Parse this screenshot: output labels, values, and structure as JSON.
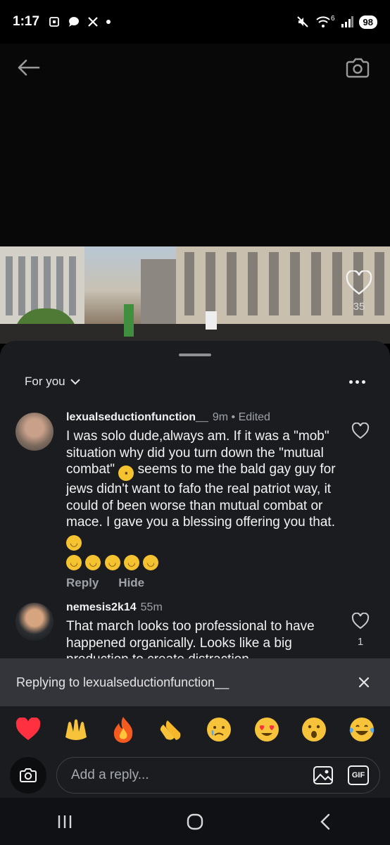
{
  "status_bar": {
    "time": "1:17",
    "notification_icons": [
      "screenshot-icon",
      "chat-bubble-icon",
      "x-logo-icon",
      "dot-icon"
    ],
    "network_label": "6",
    "battery": "98"
  },
  "post": {
    "like_count": "35"
  },
  "sheet": {
    "sort_label": "For you",
    "comments": [
      {
        "username": "lexualseductionfunction__",
        "time": "9m",
        "separator": "•",
        "edited": "Edited",
        "text_before_emoji": "I was solo dude,always am. If it was a \"mob\" situation why did you turn down the \"mutual combat\" ",
        "text_after_emoji": " seems to me the bald gay guy for jews didn't want to fafo the real patriot way, it could of been worse than mutual combat or mace. I gave you a blessing offering you that. ",
        "reply_label": "Reply",
        "hide_label": "Hide"
      },
      {
        "username": "nemesis2k14",
        "time": "55m",
        "text": "That march looks too professional to have happened organically. Looks like a big production to create distraction",
        "like_count": "1"
      }
    ]
  },
  "replying": {
    "label": "Replying to lexualseductionfunction__"
  },
  "quick_emojis": [
    "red-heart",
    "raising-hands",
    "fire",
    "clapping-hands",
    "crying-face",
    "heart-eyes",
    "surprised-face",
    "tears-of-joy"
  ],
  "composer": {
    "placeholder": "Add a reply...",
    "gif_label": "GIF"
  },
  "colors": {
    "sheet_bg": "#1a1c20",
    "replying_bg": "#33353a",
    "muted_text": "#9ea2a8",
    "heart_red": "#ff3040"
  }
}
